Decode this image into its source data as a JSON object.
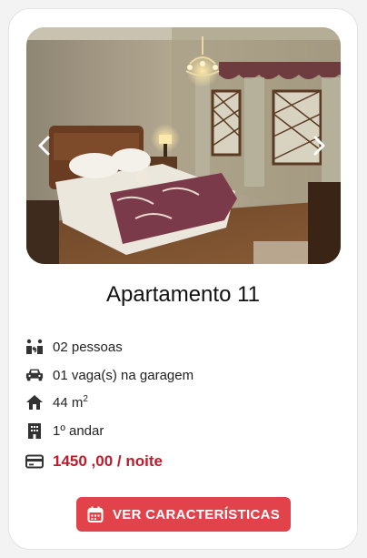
{
  "listing": {
    "title": "Apartamento 11",
    "photo_alt": "Quarto com cama de casal, lustre e janelas",
    "features": {
      "guests": "02 pessoas",
      "parking": "01 vaga(s) na garagem",
      "area_value": "44 m",
      "area_unit_sup": "2",
      "floor": "1º andar",
      "price": "1450 ,00 / noite"
    },
    "cta_label": "VER CARACTERÍSTICAS"
  },
  "icons": {
    "guests": "people-arrows-icon",
    "parking": "car-icon",
    "area": "house-icon",
    "floor": "building-icon",
    "price": "credit-card-icon",
    "cta": "calendar-icon",
    "prev": "chevron-left-icon",
    "next": "chevron-right-icon"
  },
  "colors": {
    "accent": "#e2434b",
    "price": "#c11a2a",
    "icon": "#333333"
  }
}
